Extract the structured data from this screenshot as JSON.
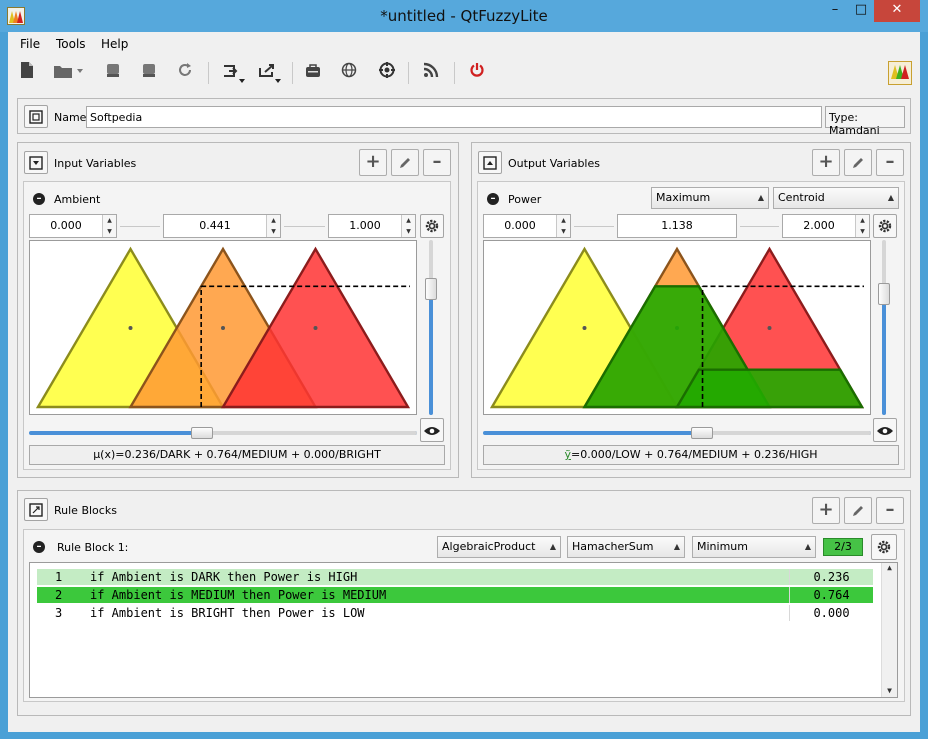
{
  "window": {
    "title": "*untitled - QtFuzzyLite",
    "minimize": "–",
    "maximize": "□",
    "close": "✕"
  },
  "menu": {
    "file": "File",
    "tools": "Tools",
    "help": "Help"
  },
  "engine": {
    "name_label": "Name",
    "name_value": "Softpedia",
    "type_label": "Type: Mamdani"
  },
  "input": {
    "header": "Input Variables",
    "variable": "Ambient",
    "min": "0.000",
    "value": "0.441",
    "max": "1.000",
    "slider": 0.441,
    "mu": "μ(x)=0.236/DARK + 0.764/MEDIUM + 0.000/BRIGHT",
    "terms": [
      {
        "name": "DARK",
        "a": 0.0,
        "b": 0.25,
        "c": 0.5,
        "degree": 0.236,
        "color": "#ffff33"
      },
      {
        "name": "MEDIUM",
        "a": 0.25,
        "b": 0.5,
        "c": 0.75,
        "degree": 0.764,
        "color": "#ff9933"
      },
      {
        "name": "BRIGHT",
        "a": 0.5,
        "b": 0.75,
        "c": 1.0,
        "degree": 0.0,
        "color": "#ff3333"
      }
    ]
  },
  "output": {
    "header": "Output Variables",
    "variable": "Power",
    "accumulation": "Maximum",
    "defuzzifier": "Centroid",
    "min": "0.000",
    "value": "1.138",
    "max": "2.000",
    "slider": 0.569,
    "mu_symbol": "ỹ",
    "mu": "=0.000/LOW + 0.764/MEDIUM + 0.236/HIGH",
    "terms": [
      {
        "name": "LOW",
        "a": 0.0,
        "b": 0.5,
        "c": 1.0,
        "degree": 0.0,
        "color": "#ffff33"
      },
      {
        "name": "MEDIUM",
        "a": 0.5,
        "b": 1.0,
        "c": 1.5,
        "degree": 0.764,
        "color": "#ff9933"
      },
      {
        "name": "HIGH",
        "a": 1.0,
        "b": 1.5,
        "c": 2.0,
        "degree": 0.236,
        "color": "#ff3333"
      }
    ]
  },
  "rules": {
    "header": "Rule Blocks",
    "block_label": "Rule Block 1:",
    "conjunction": "AlgebraicProduct",
    "disjunction": "HamacherSum",
    "activation": "Minimum",
    "count": "2/3",
    "items": [
      {
        "n": "1",
        "text": "if Ambient is DARK then Power is HIGH",
        "value": "0.236",
        "bg": "#c4ecc4"
      },
      {
        "n": "2",
        "text": "if Ambient is MEDIUM then Power is MEDIUM",
        "value": "0.764",
        "bg": "#3cc83c"
      },
      {
        "n": "3",
        "text": "if Ambient is BRIGHT then Power is LOW",
        "value": "0.000",
        "bg": "#ffffff"
      }
    ]
  }
}
